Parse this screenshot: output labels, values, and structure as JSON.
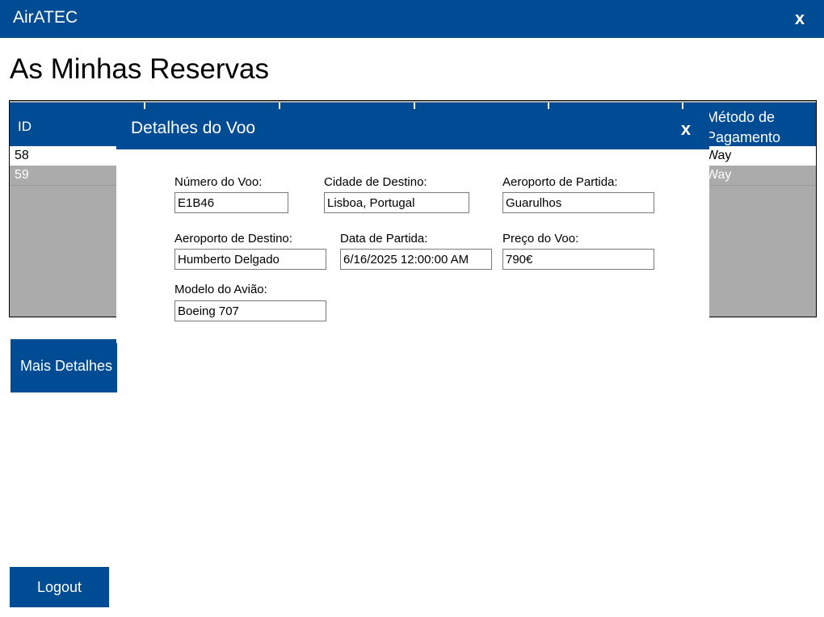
{
  "app": {
    "title": "AirATEC",
    "close_label": "x"
  },
  "page": {
    "title": "As Minhas Reservas"
  },
  "grid": {
    "header": {
      "id": "ID",
      "payment": "Método de Pagamento"
    },
    "rows": [
      {
        "id": "58",
        "payment": "Way"
      },
      {
        "id": "59",
        "payment": "Way"
      }
    ]
  },
  "buttons": {
    "details": "Mais Detalhes",
    "logout": "Logout"
  },
  "modal": {
    "title": "Detalhes do Voo",
    "close_label": "x",
    "fields": {
      "flight_number": {
        "label": "Número do Voo:",
        "value": "E1B46"
      },
      "destination_city": {
        "label": "Cidade de Destino:",
        "value": "Lisboa, Portugal"
      },
      "departure_airport": {
        "label": "Aeroporto de Partida:",
        "value": "Guarulhos"
      },
      "destination_airport": {
        "label": "Aeroporto de Destino:",
        "value": "Humberto Delgado"
      },
      "departure_date": {
        "label": "Data de Partida:",
        "value": "6/16/2025 12:00:00 AM"
      },
      "price": {
        "label": "Preço do Voo:",
        "value": "790€"
      },
      "aircraft_model": {
        "label": "Modelo do Avião:",
        "value": "Boeing 707"
      }
    }
  },
  "colors": {
    "primary": "#004C94",
    "grid_bg": "#ABABAB"
  }
}
